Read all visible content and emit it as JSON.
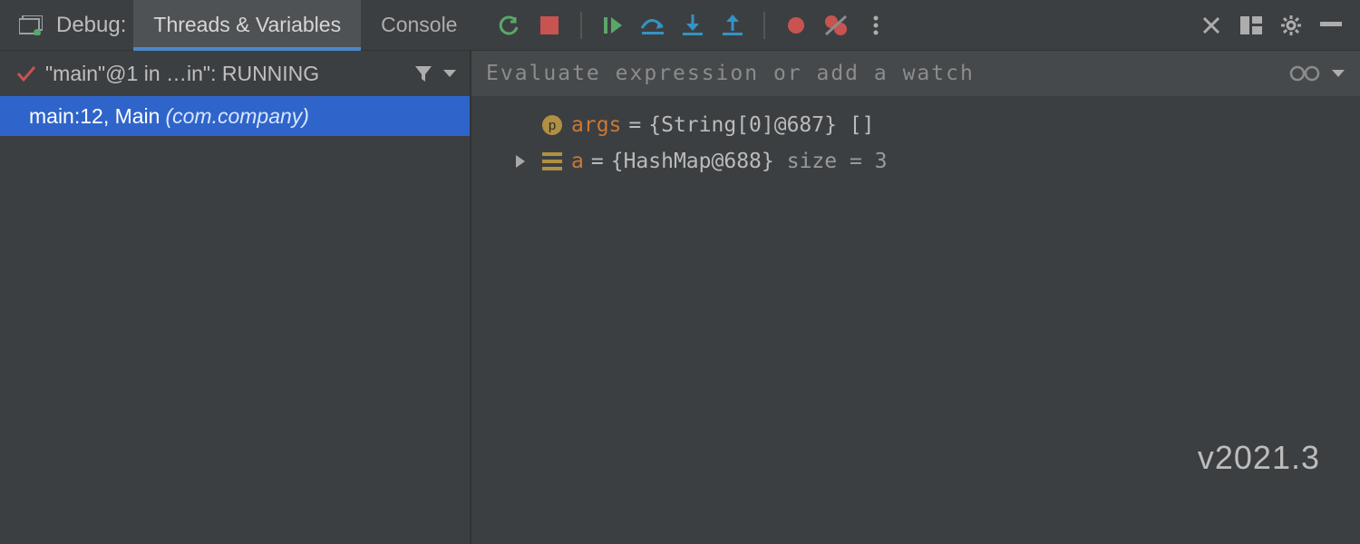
{
  "toolbar": {
    "title": "Debug:"
  },
  "tabs": {
    "threads_variables": "Threads & Variables",
    "console": "Console"
  },
  "thread_header": {
    "text": "\"main\"@1 in …in\": RUNNING"
  },
  "frame": {
    "location": "main:12, Main",
    "package": "(com.company)"
  },
  "evaluate": {
    "placeholder": "Evaluate expression or add a watch"
  },
  "variables": [
    {
      "icon": "param",
      "name": "args",
      "value": "{String[0]@687} []",
      "expandable": false
    },
    {
      "icon": "map",
      "name": "a",
      "value": "{HashMap@688}",
      "extra": "size = 3",
      "expandable": true
    }
  ],
  "version": "v2021.3"
}
